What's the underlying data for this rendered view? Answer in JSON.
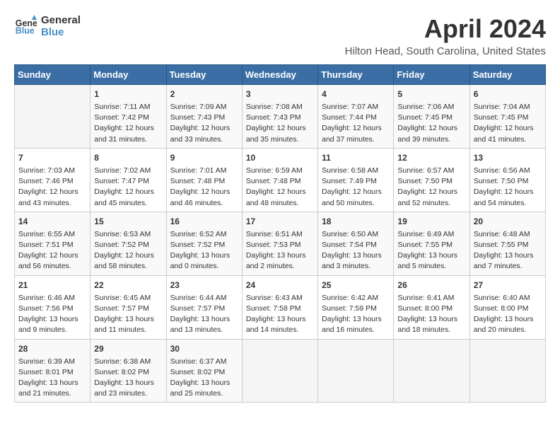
{
  "logo": {
    "line1": "General",
    "line2": "Blue"
  },
  "title": "April 2024",
  "location": "Hilton Head, South Carolina, United States",
  "days_header": [
    "Sunday",
    "Monday",
    "Tuesday",
    "Wednesday",
    "Thursday",
    "Friday",
    "Saturday"
  ],
  "weeks": [
    [
      {
        "day": "",
        "content": ""
      },
      {
        "day": "1",
        "content": "Sunrise: 7:11 AM\nSunset: 7:42 PM\nDaylight: 12 hours\nand 31 minutes."
      },
      {
        "day": "2",
        "content": "Sunrise: 7:09 AM\nSunset: 7:43 PM\nDaylight: 12 hours\nand 33 minutes."
      },
      {
        "day": "3",
        "content": "Sunrise: 7:08 AM\nSunset: 7:43 PM\nDaylight: 12 hours\nand 35 minutes."
      },
      {
        "day": "4",
        "content": "Sunrise: 7:07 AM\nSunset: 7:44 PM\nDaylight: 12 hours\nand 37 minutes."
      },
      {
        "day": "5",
        "content": "Sunrise: 7:06 AM\nSunset: 7:45 PM\nDaylight: 12 hours\nand 39 minutes."
      },
      {
        "day": "6",
        "content": "Sunrise: 7:04 AM\nSunset: 7:45 PM\nDaylight: 12 hours\nand 41 minutes."
      }
    ],
    [
      {
        "day": "7",
        "content": "Sunrise: 7:03 AM\nSunset: 7:46 PM\nDaylight: 12 hours\nand 43 minutes."
      },
      {
        "day": "8",
        "content": "Sunrise: 7:02 AM\nSunset: 7:47 PM\nDaylight: 12 hours\nand 45 minutes."
      },
      {
        "day": "9",
        "content": "Sunrise: 7:01 AM\nSunset: 7:48 PM\nDaylight: 12 hours\nand 46 minutes."
      },
      {
        "day": "10",
        "content": "Sunrise: 6:59 AM\nSunset: 7:48 PM\nDaylight: 12 hours\nand 48 minutes."
      },
      {
        "day": "11",
        "content": "Sunrise: 6:58 AM\nSunset: 7:49 PM\nDaylight: 12 hours\nand 50 minutes."
      },
      {
        "day": "12",
        "content": "Sunrise: 6:57 AM\nSunset: 7:50 PM\nDaylight: 12 hours\nand 52 minutes."
      },
      {
        "day": "13",
        "content": "Sunrise: 6:56 AM\nSunset: 7:50 PM\nDaylight: 12 hours\nand 54 minutes."
      }
    ],
    [
      {
        "day": "14",
        "content": "Sunrise: 6:55 AM\nSunset: 7:51 PM\nDaylight: 12 hours\nand 56 minutes."
      },
      {
        "day": "15",
        "content": "Sunrise: 6:53 AM\nSunset: 7:52 PM\nDaylight: 12 hours\nand 58 minutes."
      },
      {
        "day": "16",
        "content": "Sunrise: 6:52 AM\nSunset: 7:52 PM\nDaylight: 13 hours\nand 0 minutes."
      },
      {
        "day": "17",
        "content": "Sunrise: 6:51 AM\nSunset: 7:53 PM\nDaylight: 13 hours\nand 2 minutes."
      },
      {
        "day": "18",
        "content": "Sunrise: 6:50 AM\nSunset: 7:54 PM\nDaylight: 13 hours\nand 3 minutes."
      },
      {
        "day": "19",
        "content": "Sunrise: 6:49 AM\nSunset: 7:55 PM\nDaylight: 13 hours\nand 5 minutes."
      },
      {
        "day": "20",
        "content": "Sunrise: 6:48 AM\nSunset: 7:55 PM\nDaylight: 13 hours\nand 7 minutes."
      }
    ],
    [
      {
        "day": "21",
        "content": "Sunrise: 6:46 AM\nSunset: 7:56 PM\nDaylight: 13 hours\nand 9 minutes."
      },
      {
        "day": "22",
        "content": "Sunrise: 6:45 AM\nSunset: 7:57 PM\nDaylight: 13 hours\nand 11 minutes."
      },
      {
        "day": "23",
        "content": "Sunrise: 6:44 AM\nSunset: 7:57 PM\nDaylight: 13 hours\nand 13 minutes."
      },
      {
        "day": "24",
        "content": "Sunrise: 6:43 AM\nSunset: 7:58 PM\nDaylight: 13 hours\nand 14 minutes."
      },
      {
        "day": "25",
        "content": "Sunrise: 6:42 AM\nSunset: 7:59 PM\nDaylight: 13 hours\nand 16 minutes."
      },
      {
        "day": "26",
        "content": "Sunrise: 6:41 AM\nSunset: 8:00 PM\nDaylight: 13 hours\nand 18 minutes."
      },
      {
        "day": "27",
        "content": "Sunrise: 6:40 AM\nSunset: 8:00 PM\nDaylight: 13 hours\nand 20 minutes."
      }
    ],
    [
      {
        "day": "28",
        "content": "Sunrise: 6:39 AM\nSunset: 8:01 PM\nDaylight: 13 hours\nand 21 minutes."
      },
      {
        "day": "29",
        "content": "Sunrise: 6:38 AM\nSunset: 8:02 PM\nDaylight: 13 hours\nand 23 minutes."
      },
      {
        "day": "30",
        "content": "Sunrise: 6:37 AM\nSunset: 8:02 PM\nDaylight: 13 hours\nand 25 minutes."
      },
      {
        "day": "",
        "content": ""
      },
      {
        "day": "",
        "content": ""
      },
      {
        "day": "",
        "content": ""
      },
      {
        "day": "",
        "content": ""
      }
    ]
  ]
}
